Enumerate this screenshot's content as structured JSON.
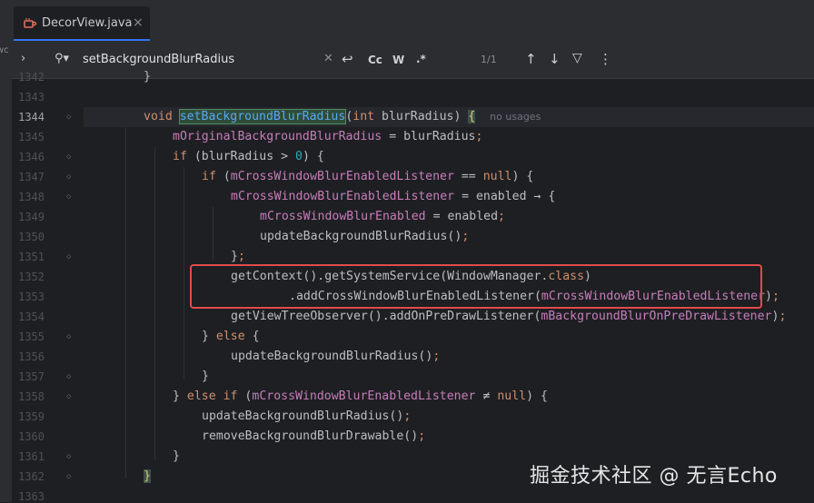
{
  "tab": {
    "title": "DecorView.java",
    "close": "×",
    "icon": "java-file-icon"
  },
  "left_panel": {
    "label": "wc"
  },
  "search": {
    "query": "setBackgroundBlurRadius",
    "match_count": "1/1",
    "match_case_label": "Cc",
    "words_label": "W",
    "regex_label": ".*",
    "icons": [
      "chevron-right-icon",
      "search-icon",
      "clear-icon",
      "replace-icon",
      "arrow-up-icon",
      "arrow-down-icon",
      "filter-icon",
      "more-icon"
    ]
  },
  "editor": {
    "line_numbers": [
      "1342",
      "1343",
      "1344",
      "1345",
      "1346",
      "1347",
      "1348",
      "1349",
      "1350",
      "1351",
      "1352",
      "1353",
      "1354",
      "1355",
      "1356",
      "1357",
      "1358",
      "1359",
      "1360",
      "1361",
      "1362",
      "1363"
    ],
    "current_line": "1344",
    "lines": [
      [
        {
          "t": "}"
        }
      ],
      [],
      [
        {
          "t": "void ",
          "c": "kw"
        },
        {
          "t": "setBackgroundBlurRadius",
          "c": "match"
        },
        {
          "t": "("
        },
        {
          "t": "int ",
          "c": "kw"
        },
        {
          "t": "blurRadius) "
        },
        {
          "t": "{",
          "c": "brace-hl"
        },
        {
          "t": "  "
        },
        {
          "t": "no usages",
          "c": "hint"
        }
      ],
      [
        {
          "t": "mOriginalBackgroundBlurRadius",
          "c": "fld"
        },
        {
          "t": " = blurRadius"
        },
        {
          "t": ";",
          "c": "kw"
        }
      ],
      [
        {
          "t": "if ",
          "c": "kw"
        },
        {
          "t": "(blurRadius > "
        },
        {
          "t": "0",
          "c": "num"
        },
        {
          "t": ") {"
        }
      ],
      [
        {
          "t": "if ",
          "c": "kw"
        },
        {
          "t": "("
        },
        {
          "t": "mCrossWindowBlurEnabledListener",
          "c": "fld"
        },
        {
          "t": " == "
        },
        {
          "t": "null",
          "c": "kw"
        },
        {
          "t": ") {"
        }
      ],
      [
        {
          "t": "mCrossWindowBlurEnabledListener",
          "c": "fld"
        },
        {
          "t": " = enabled → {"
        }
      ],
      [
        {
          "t": "mCrossWindowBlurEnabled",
          "c": "fld"
        },
        {
          "t": " = enabled"
        },
        {
          "t": ";",
          "c": "kw"
        }
      ],
      [
        {
          "t": "updateBackgroundBlurRadius()"
        },
        {
          "t": ";",
          "c": "kw"
        }
      ],
      [
        {
          "t": "}"
        },
        {
          "t": ";",
          "c": "kw"
        }
      ],
      [
        {
          "t": "getContext().getSystemService(WindowManager."
        },
        {
          "t": "class",
          "c": "kw"
        },
        {
          "t": ")"
        }
      ],
      [
        {
          "t": ".addCrossWindowBlurEnabledListener("
        },
        {
          "t": "mCrossWindowBlurEnabledListener",
          "c": "fld"
        },
        {
          "t": ")"
        },
        {
          "t": ";",
          "c": "kw"
        }
      ],
      [
        {
          "t": "getViewTreeObserver().addOnPreDrawListener("
        },
        {
          "t": "mBackgroundBlurOnPreDrawListener",
          "c": "fld"
        },
        {
          "t": ")"
        },
        {
          "t": ";",
          "c": "kw"
        }
      ],
      [
        {
          "t": "} "
        },
        {
          "t": "else ",
          "c": "kw"
        },
        {
          "t": "{"
        }
      ],
      [
        {
          "t": "updateBackgroundBlurRadius()"
        },
        {
          "t": ";",
          "c": "kw"
        }
      ],
      [
        {
          "t": "}"
        }
      ],
      [
        {
          "t": "} "
        },
        {
          "t": "else if ",
          "c": "kw"
        },
        {
          "t": "("
        },
        {
          "t": "mCrossWindowBlurEnabledListener",
          "c": "fld"
        },
        {
          "t": " ≠ "
        },
        {
          "t": "null",
          "c": "kw"
        },
        {
          "t": ") {"
        }
      ],
      [
        {
          "t": "updateBackgroundBlurRadius()"
        },
        {
          "t": ";",
          "c": "kw"
        }
      ],
      [
        {
          "t": "removeBackgroundBlurDrawable()"
        },
        {
          "t": ";",
          "c": "kw"
        }
      ],
      [
        {
          "t": "}"
        }
      ],
      [
        {
          "t": "}",
          "c": "brace-hl"
        }
      ],
      []
    ],
    "indents": [
      1,
      0,
      1,
      2,
      2,
      3,
      4,
      5,
      5,
      4,
      4,
      6,
      4,
      3,
      4,
      3,
      2,
      3,
      3,
      2,
      1,
      0
    ]
  },
  "watermark": "掘金技术社区 @ 无言Echo",
  "colors": {
    "background": "#1e1f22",
    "keyword": "#cf8e6d",
    "field": "#c77dbb",
    "number": "#2aacb8",
    "annotation_box": "#e14b4b"
  }
}
